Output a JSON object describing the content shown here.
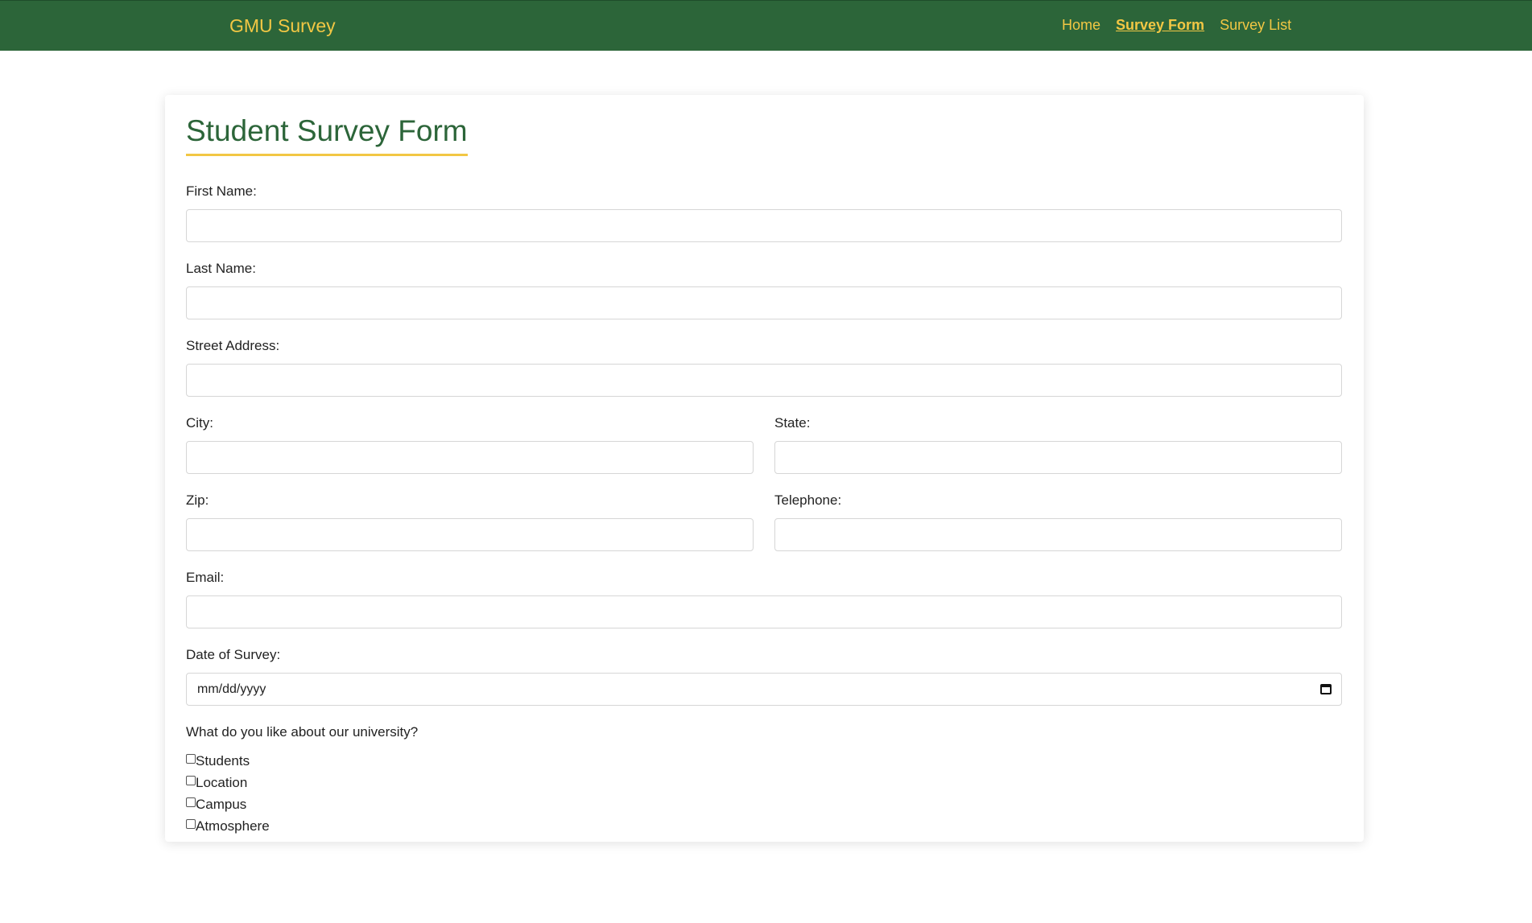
{
  "navbar": {
    "brand": "GMU Survey",
    "links": [
      {
        "label": "Home",
        "active": false
      },
      {
        "label": "Survey Form",
        "active": true
      },
      {
        "label": "Survey List",
        "active": false
      }
    ]
  },
  "form": {
    "title": "Student Survey Form",
    "first_name_label": "First Name:",
    "last_name_label": "Last Name:",
    "street_label": "Street Address:",
    "city_label": "City:",
    "state_label": "State:",
    "zip_label": "Zip:",
    "telephone_label": "Telephone:",
    "email_label": "Email:",
    "date_label": "Date of Survey:",
    "date_placeholder": "mm/dd/yyyy",
    "likes_question": "What do you like about our university?",
    "likes_options": [
      "Students",
      "Location",
      "Campus",
      "Atmosphere"
    ]
  },
  "colors": {
    "nav_bg": "#2c6539",
    "accent": "#f2c744",
    "title": "#2c6539"
  }
}
